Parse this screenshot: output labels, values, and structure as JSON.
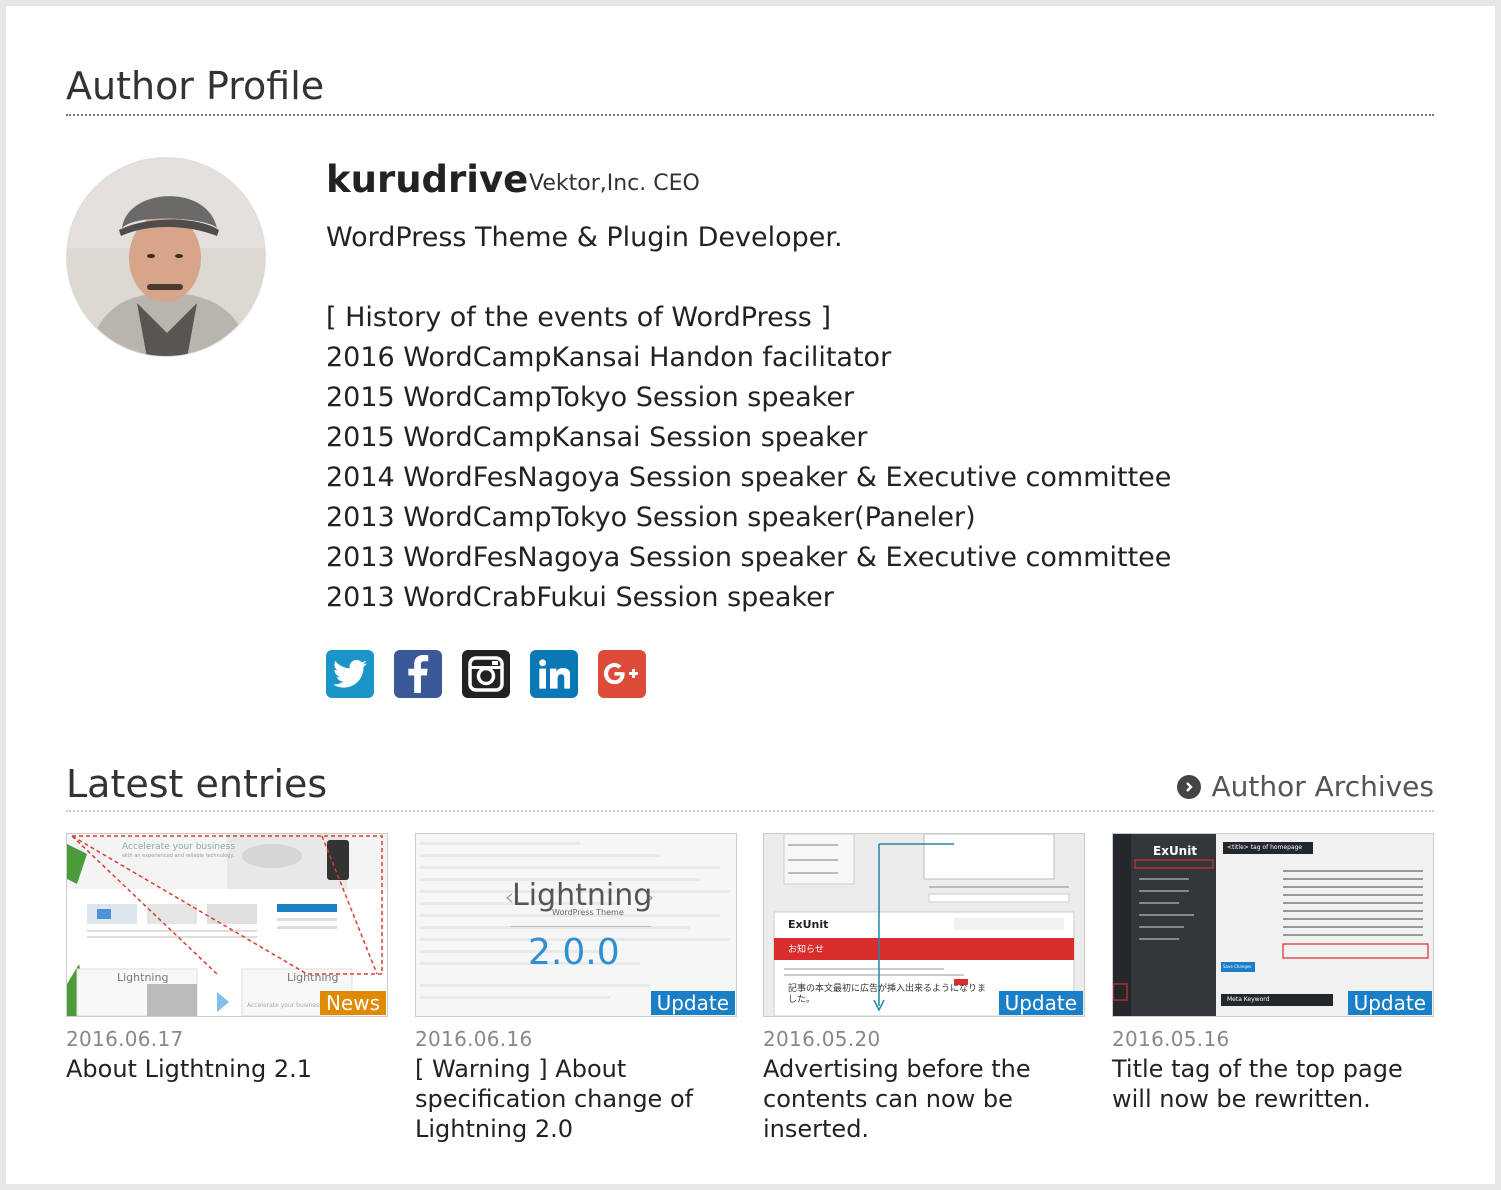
{
  "profile": {
    "heading": "Author Profile",
    "name": "kurudrive",
    "role": "Vektor,Inc. CEO",
    "bio_lines": [
      "WordPress Theme & Plugin Developer.",
      "",
      "[ History of the events of WordPress ]",
      "2016 WordCampKansai Handon facilitator",
      "2015 WordCampTokyo Session speaker",
      "2015 WordCampKansai Session speaker",
      "2014 WordFesNagoya Session speaker & Executive committee",
      "2013 WordCampTokyo Session speaker(Paneler)",
      "2013 WordFesNagoya Session speaker & Executive committee",
      "2013 WordCrabFukui Session speaker"
    ],
    "socials": [
      {
        "icon": "twitter-icon",
        "color": "#1b95c7"
      },
      {
        "icon": "facebook-icon",
        "color": "#3b5998"
      },
      {
        "icon": "instagram-icon",
        "color": "#222222"
      },
      {
        "icon": "linkedin-icon",
        "color": "#0a78b5"
      },
      {
        "icon": "google-plus-icon",
        "color": "#dd4b39"
      }
    ]
  },
  "entries_section": {
    "heading": "Latest entries",
    "archives_link": "Author Archives"
  },
  "entries": [
    {
      "date": "2016.06.17",
      "title": "About Ligthtning 2.1",
      "category": "News",
      "category_color": "#e08a00"
    },
    {
      "date": "2016.06.16",
      "title": "[ Warning ] About specification change of Lightning 2.0",
      "category": "Update",
      "category_color": "#1a7fc6"
    },
    {
      "date": "2016.05.20",
      "title": "Advertising before the contents can now be inserted.",
      "category": "Update",
      "category_color": "#1a7fc6"
    },
    {
      "date": "2016.05.16",
      "title": "Title tag of the top page will now be rewritten.",
      "category": "Update",
      "category_color": "#1a7fc6"
    }
  ],
  "thumbs": {
    "t1": {
      "heading": "Accelerate your business",
      "sub": "with an experienced and reliable technology.",
      "logo": "Lightning",
      "footer": "Accelerate your business"
    },
    "t2": {
      "logo": "Lightning",
      "sub": "WordPress Theme",
      "version": "2.0.0"
    },
    "t3": {
      "brand": "ExUnit",
      "notice": "お知らせ",
      "text": "記事の本文最初に広告が挿入出来るようになりました。"
    },
    "t4": {
      "brand": "ExUnit",
      "heading": "<title> tag of homepage",
      "button": "Save Changes",
      "meta": "Meta Keyword"
    }
  }
}
